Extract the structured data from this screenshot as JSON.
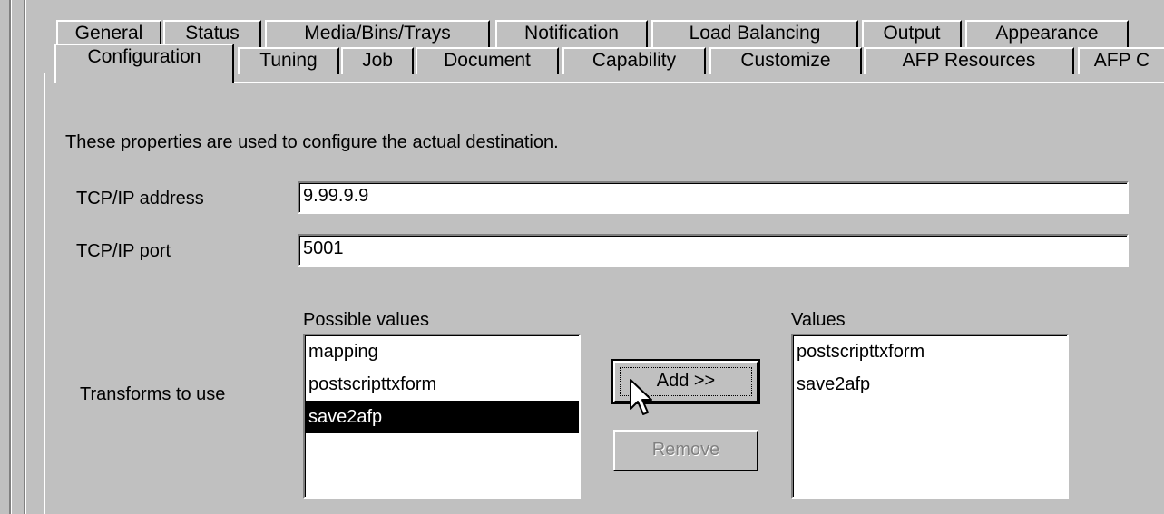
{
  "tabs_row1": [
    "General",
    "Status",
    "Media/Bins/Trays",
    "Notification",
    "Load Balancing",
    "Output",
    "Appearance"
  ],
  "tabs_row2": [
    "Configuration",
    "Tuning",
    "Job",
    "Document",
    "Capability",
    "Customize",
    "AFP Resources",
    "AFP C"
  ],
  "active_tab": "Configuration",
  "description": "These properties are used to configure the actual destination.",
  "tcpip_address": {
    "label": "TCP/IP address",
    "value": "9.99.9.9"
  },
  "tcpip_port": {
    "label": "TCP/IP port",
    "value": "5001"
  },
  "transforms": {
    "label": "Transforms to use",
    "possible_label": "Possible values",
    "possible_values": [
      "mapping",
      "postscripttxform",
      "save2afp"
    ],
    "selected_possible": "save2afp",
    "values_label": "Values",
    "values": [
      "postscripttxform",
      "save2afp"
    ],
    "add_label": "Add >>",
    "remove_label": "Remove"
  },
  "icons": {
    "cursor": "arrow-cursor-icon"
  }
}
